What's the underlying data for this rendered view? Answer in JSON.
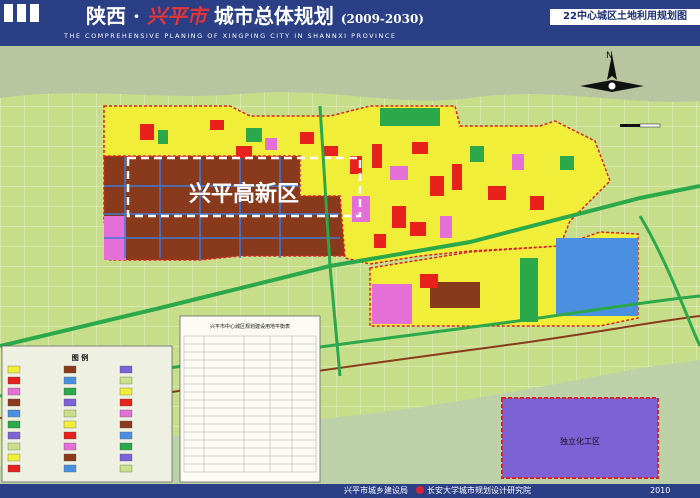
{
  "header": {
    "title_prefix": "陕西 ·",
    "title_city": "兴平市",
    "title_main": "城市总体规划",
    "title_years": "(2009-2030)",
    "subtitle": "THE COMPREHENSIVE PLANING OF XINGPING CITY IN SHANNXI PROVINCE",
    "sheet_title": "22中心城区土地利用规划图"
  },
  "map": {
    "zone_label": "兴平高新区",
    "industrial_zone_label": "独立化工区",
    "north_arrow_label": "N",
    "legend_title": "图 例",
    "table_title": "兴平市中心城区规划建设用地平衡表"
  },
  "footer": {
    "left_org": "兴平市城乡建设局",
    "right_org": "长安大学城市规划设计研究院",
    "year": "2010"
  },
  "colors": {
    "header_bg": "#2a3f86",
    "farmland": "#c9e08a",
    "residential": "#f1ee3a",
    "industrial": "#8a3a1c",
    "commercial": "#e8211c",
    "green": "#2aa84a",
    "chemical_zone": "#7d62d6",
    "warehouse": "#4b8fe0",
    "education": "#e46fd6"
  }
}
